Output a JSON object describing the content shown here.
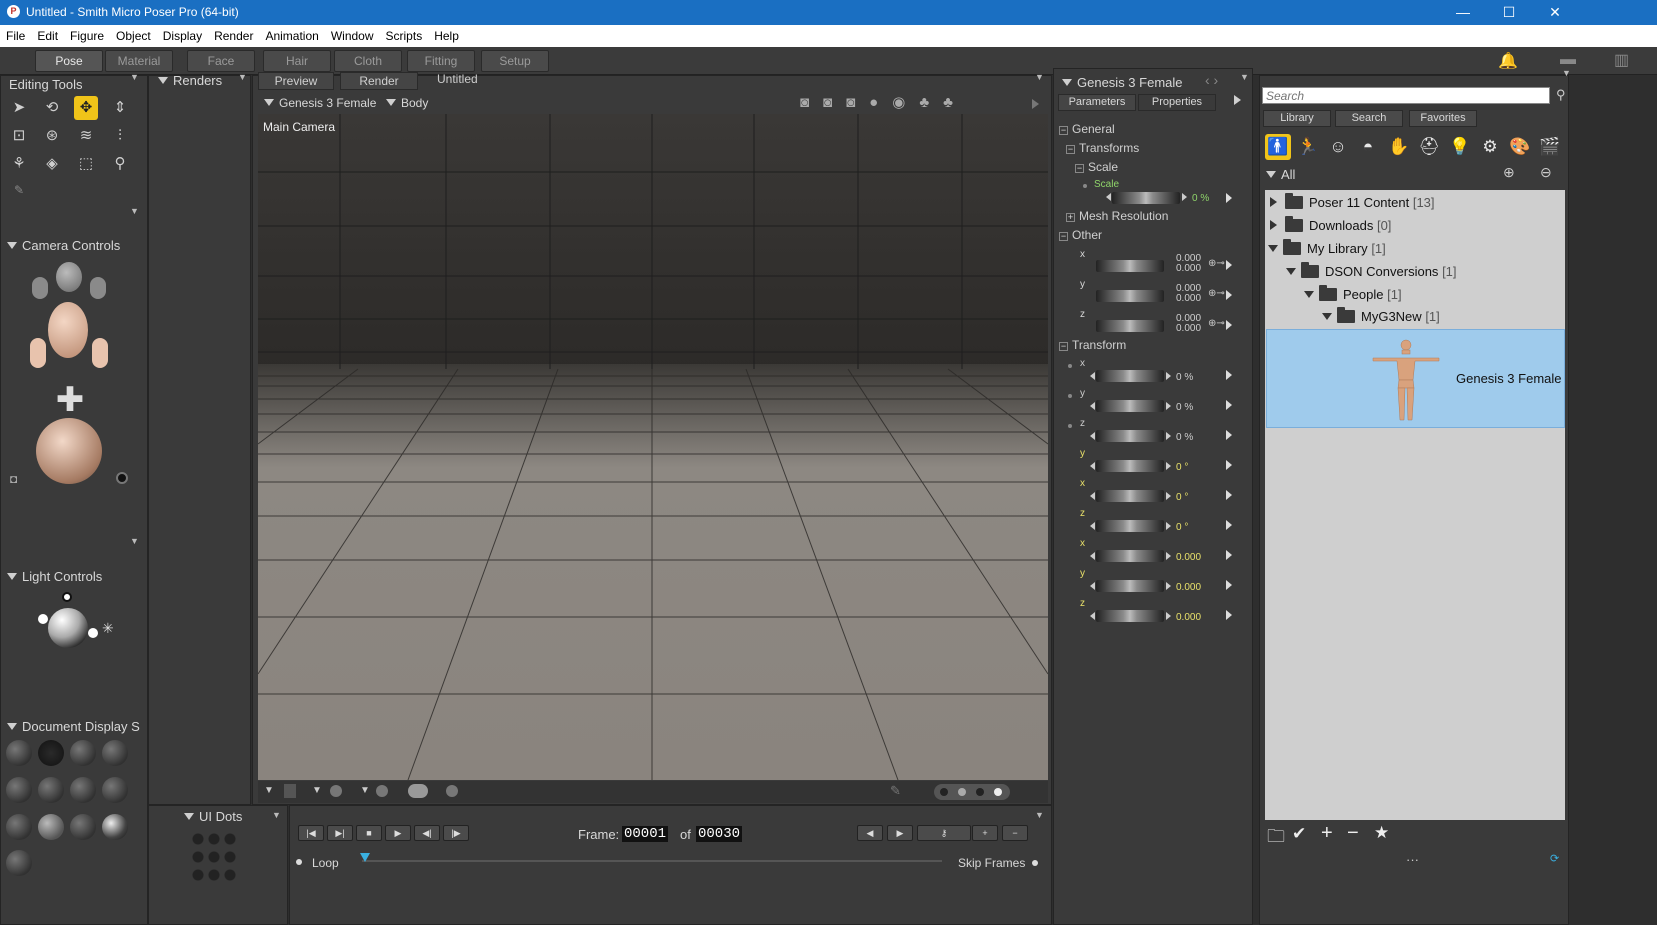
{
  "window": {
    "title": "Untitled - Smith Micro Poser Pro  (64-bit)",
    "app_icon": "poser-icon"
  },
  "menu": [
    "File",
    "Edit",
    "Figure",
    "Object",
    "Display",
    "Render",
    "Animation",
    "Window",
    "Scripts",
    "Help"
  ],
  "rooms": [
    "Pose",
    "Material",
    "Face",
    "Hair",
    "Cloth",
    "Fitting",
    "Setup"
  ],
  "left": {
    "editing_tools": "Editing Tools",
    "renders": "Renders",
    "camera_controls": "Camera Controls",
    "light_controls": "Light Controls",
    "document_display": "Document Display S",
    "ui_dots": "UI Dots"
  },
  "doc": {
    "tabs": [
      "Preview",
      "Render"
    ],
    "doc_title": "Untitled",
    "figure_select": "Genesis 3 Female",
    "actor_select": "Body",
    "camera_label": "Main Camera"
  },
  "params": {
    "title": "Genesis 3 Female",
    "tabs": [
      "Parameters",
      "Properties"
    ],
    "groups": {
      "general": "General",
      "transforms": "Transforms",
      "scale": "Scale",
      "scale_param": "Scale",
      "mesh": "Mesh Resolution",
      "other": "Other",
      "transform": "Transform"
    },
    "scale_value": "0 %",
    "other_rows": [
      {
        "axis": "x",
        "v1": "0.000",
        "v2": "0.000"
      },
      {
        "axis": "y",
        "v1": "0.000",
        "v2": "0.000"
      },
      {
        "axis": "z",
        "v1": "0.000",
        "v2": "0.000"
      }
    ],
    "transform_rows": [
      {
        "axis": "x",
        "value": "0 %"
      },
      {
        "axis": "y",
        "value": "0 %"
      },
      {
        "axis": "z",
        "value": "0 %"
      },
      {
        "axis": "y",
        "value": "0 °"
      },
      {
        "axis": "x",
        "value": "0 °"
      },
      {
        "axis": "z",
        "value": "0 °"
      },
      {
        "axis": "x",
        "value": "0.000"
      },
      {
        "axis": "y",
        "value": "0.000"
      },
      {
        "axis": "z",
        "value": "0.000"
      }
    ]
  },
  "library": {
    "search_placeholder": "Search",
    "tabs": [
      "Library",
      "Search",
      "Favorites"
    ],
    "filter": "All",
    "tree": [
      {
        "label": "Poser 11 Content",
        "count": "[13]"
      },
      {
        "label": "Downloads",
        "count": "[0]"
      },
      {
        "label": "My Library",
        "count": "[1]"
      },
      {
        "label": "DSON Conversions",
        "count": "[1]"
      },
      {
        "label": "People",
        "count": "[1]"
      },
      {
        "label": "MyG3New",
        "count": "[1]"
      }
    ],
    "selected_item": "Genesis 3 Female",
    "more": "···"
  },
  "timeline": {
    "frame_label": "Frame:",
    "frame": "00001",
    "of_label": "of",
    "total": "00030",
    "loop": "Loop",
    "skip": "Skip Frames"
  },
  "colors": {
    "accent": "#f0c419",
    "titlebar": "#1a6fc2",
    "selection": "#9fcbec"
  }
}
